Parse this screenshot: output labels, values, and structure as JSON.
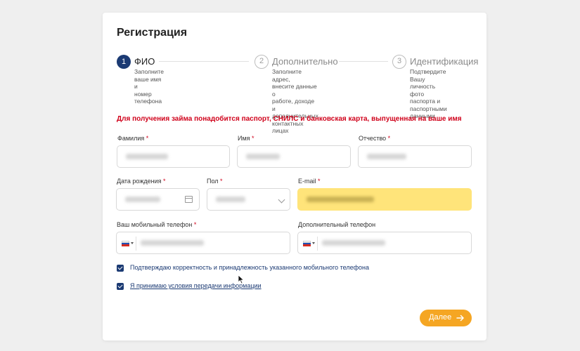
{
  "form": {
    "title": "Регистрация",
    "steps": [
      {
        "num": "1",
        "label": "ФИО",
        "desc": "Заполните ваше имя и номер телефона",
        "desc_lines": [
          "Заполните ваше имя и",
          "номер телефона"
        ],
        "active": true
      },
      {
        "num": "2",
        "label": "Дополнительно",
        "desc_lines": [
          "Заполните адрес,",
          "внесите данные о",
          "работе, доходе и",
          "дополнительных",
          "контактных лицах"
        ],
        "active": false
      },
      {
        "num": "3",
        "label": "Идентификация",
        "desc_lines": [
          "Подтвердите Вашу",
          "личность фото",
          "паспорта и",
          "паспортными",
          "данными"
        ],
        "active": false
      }
    ],
    "notice": "Для получения займа понадобится паспорт, СНИЛС и банковская карта, выпущенная на ваше имя",
    "fields": {
      "last_name": {
        "label": "Фамилия",
        "required": "*"
      },
      "first_name": {
        "label": "Имя",
        "required": "*"
      },
      "patronymic": {
        "label": "Отчество",
        "required": "*"
      },
      "birth_date": {
        "label": "Дата рождения",
        "required": "*"
      },
      "gender": {
        "label": "Пол",
        "required": "*"
      },
      "email": {
        "label": "E-mail",
        "required": "*"
      },
      "mobile": {
        "label": "Ваш мобильный телефон",
        "required": "*"
      },
      "extra_phone": {
        "label": "Дополнительный телефон",
        "required": ""
      }
    },
    "checkboxes": {
      "confirm_phone": {
        "label": "Подтверждаю корректность и принадлежность указанного мобильного телефона",
        "checked": true
      },
      "accept_terms": {
        "label": "Я принимаю условия передачи информации",
        "checked": true
      }
    },
    "next_button": {
      "label": "Далее"
    }
  },
  "colors": {
    "accent_navy": "#1b3a73",
    "button_orange": "#f5a623",
    "required_red": "#d0021b",
    "email_highlight": "#ffe47a"
  }
}
